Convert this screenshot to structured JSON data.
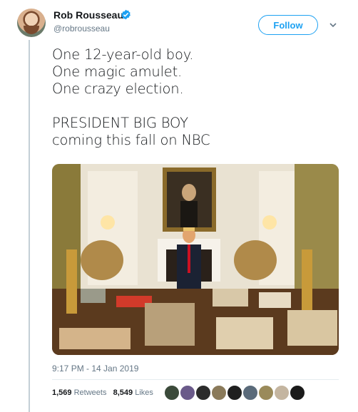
{
  "author": {
    "name": "Rob Rousseau",
    "handle": "@robrousseau",
    "verified": true
  },
  "follow_button": {
    "label": "Follow"
  },
  "tweet": {
    "lines": [
      "One 12-year-old boy.",
      "One magic amulet.",
      "One crazy election.",
      "",
      "PRESIDENT BIG BOY",
      "coming this fall on NBC"
    ],
    "timestamp": "9:17 PM - 14 Jan 2019"
  },
  "stats": {
    "retweets_count": "1,569",
    "retweets_label": "Retweets",
    "likes_count": "8,549",
    "likes_label": "Likes"
  },
  "liker_avatars": [
    "#3b4a3a",
    "#6a5a8a",
    "#2b2b2b",
    "#8a7a5a",
    "#1f1f1f",
    "#5a6a7a",
    "#9a8a5a",
    "#c4b5a0",
    "#1a1a1a"
  ],
  "colors": {
    "accent": "#1da1f2",
    "text": "#14171a",
    "muted": "#657786"
  }
}
